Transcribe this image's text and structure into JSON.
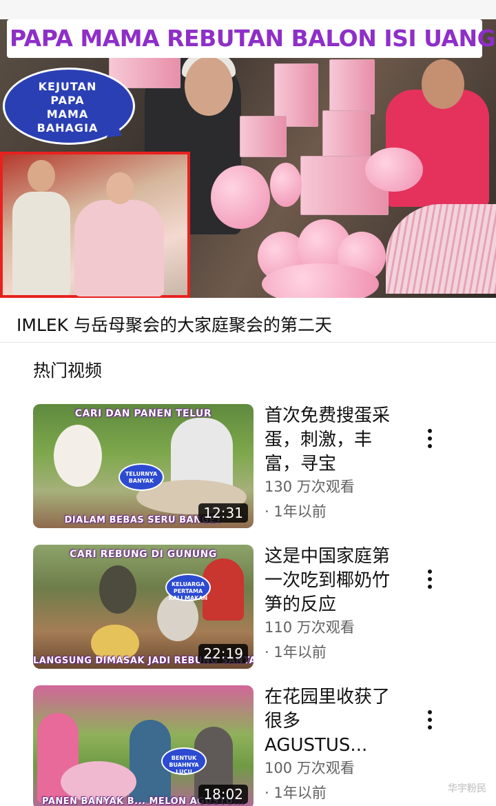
{
  "hero": {
    "title": "PAPA MAMA REBUTAN BALON ISI UANG",
    "bubble_lines": [
      "KEJUTAN",
      "PAPA",
      "MAMA",
      "BAHAGIA"
    ]
  },
  "video": {
    "title": "IMLEK 与岳母聚会的大家庭聚会的第二天"
  },
  "section": {
    "title": "热门视频"
  },
  "items": [
    {
      "title": "首次免费搜蛋采蛋，刺激，丰富，寻宝",
      "views": "130 万次观看",
      "age": "· 1年以前",
      "duration": "12:31",
      "caption_top": "CARI DAN PANEN TELUR",
      "caption_bottom": "DIALAM BEBAS SERU BANGET",
      "badge": "TELURNYA BANYAK"
    },
    {
      "title": "这是中国家庭第一次吃到椰奶竹笋的反应",
      "views": "110 万次观看",
      "age": "· 1年以前",
      "duration": "22:19",
      "caption_top": "CARI REBUNG DI GUNUNG",
      "caption_bottom": "LANGSUNG DIMASAK JADI REBUNG SANTAN",
      "badge": "KELUARGA PERTAMA KALI MAKAN"
    },
    {
      "title": "在花园里收获了很多AGUSTUS...",
      "views": "100 万次观看",
      "age": "· 1年以前",
      "duration": "18:02",
      "caption_top": "",
      "caption_bottom": "PANEN BANYAK B... MELON AGUSTU...",
      "badge": "BENTUK BUAHNYA LUCU"
    }
  ],
  "watermark": "华宇粉民",
  "colors": {
    "hero_title": "#8e2fc8",
    "bubble": "#2b3fb5",
    "inset_border": "#e8211f",
    "duration_bg": "#000000",
    "meta_text": "#606060"
  },
  "icons": {
    "more": "more-vert-icon"
  }
}
